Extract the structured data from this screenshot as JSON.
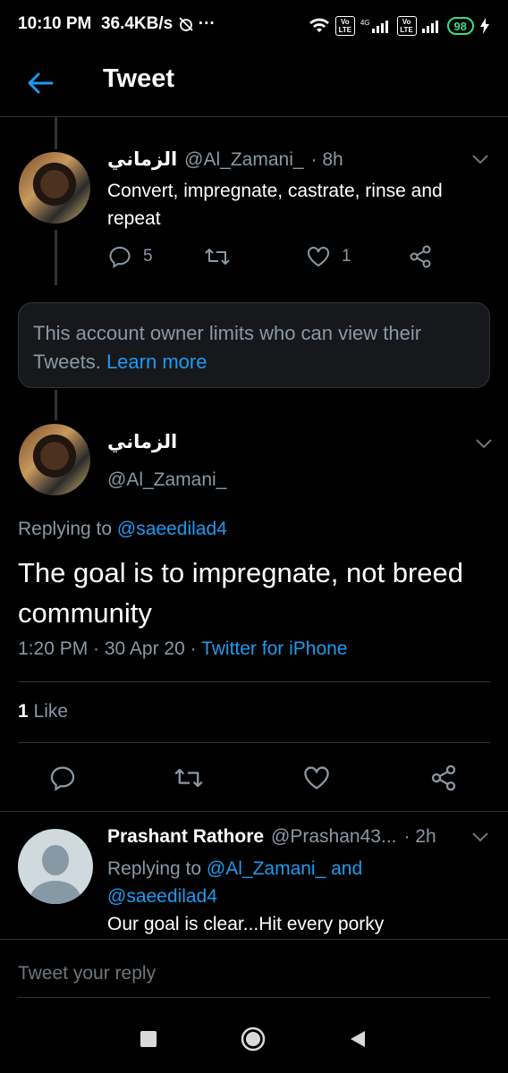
{
  "status_bar": {
    "time": "10:10 PM",
    "speed": "36.4KB/s",
    "lte1": "Vo LTE",
    "net4g": "4G",
    "lte2": "Vo LTE",
    "battery": "98"
  },
  "header": {
    "title": "Tweet"
  },
  "parent_tweet": {
    "display_name": "الزماني",
    "handle": "@Al_Zamani_",
    "time": "· 8h",
    "text": "Convert, impregnate, castrate, rinse and repeat",
    "reply_count": "5",
    "like_count": "1"
  },
  "notice": {
    "text": "This account owner limits who can view their Tweets.",
    "link": "Learn more"
  },
  "main_tweet": {
    "display_name": "الزماني",
    "handle": "@Al_Zamani_",
    "replying_label": "Replying to",
    "replying_to": "@saeedilad4",
    "text": "The goal is to impregnate, not breed community",
    "timestamp": "1:20 PM · 30 Apr 20 ·",
    "source": "Twitter for iPhone",
    "likes_count": "1",
    "likes_label": "Like"
  },
  "reply_tweet": {
    "display_name": "Prashant Rathore",
    "handle": "@Prashan43...",
    "time": "· 2h",
    "replying_label": "Replying to",
    "replying_to": "@Al_Zamani_ and @saeedilad4",
    "text": "Our goal is clear...Hit every porky"
  },
  "reply_box": {
    "placeholder": "Tweet your reply"
  },
  "colors": {
    "accent": "#1d9bf0",
    "background": "#000000",
    "muted": "#8b98a5",
    "divider": "#2f3336"
  },
  "icons": [
    "back-arrow-icon",
    "reply-icon",
    "retweet-icon",
    "like-icon",
    "share-icon",
    "chevron-down-icon",
    "recents-icon",
    "home-icon",
    "back-nav-icon"
  ]
}
